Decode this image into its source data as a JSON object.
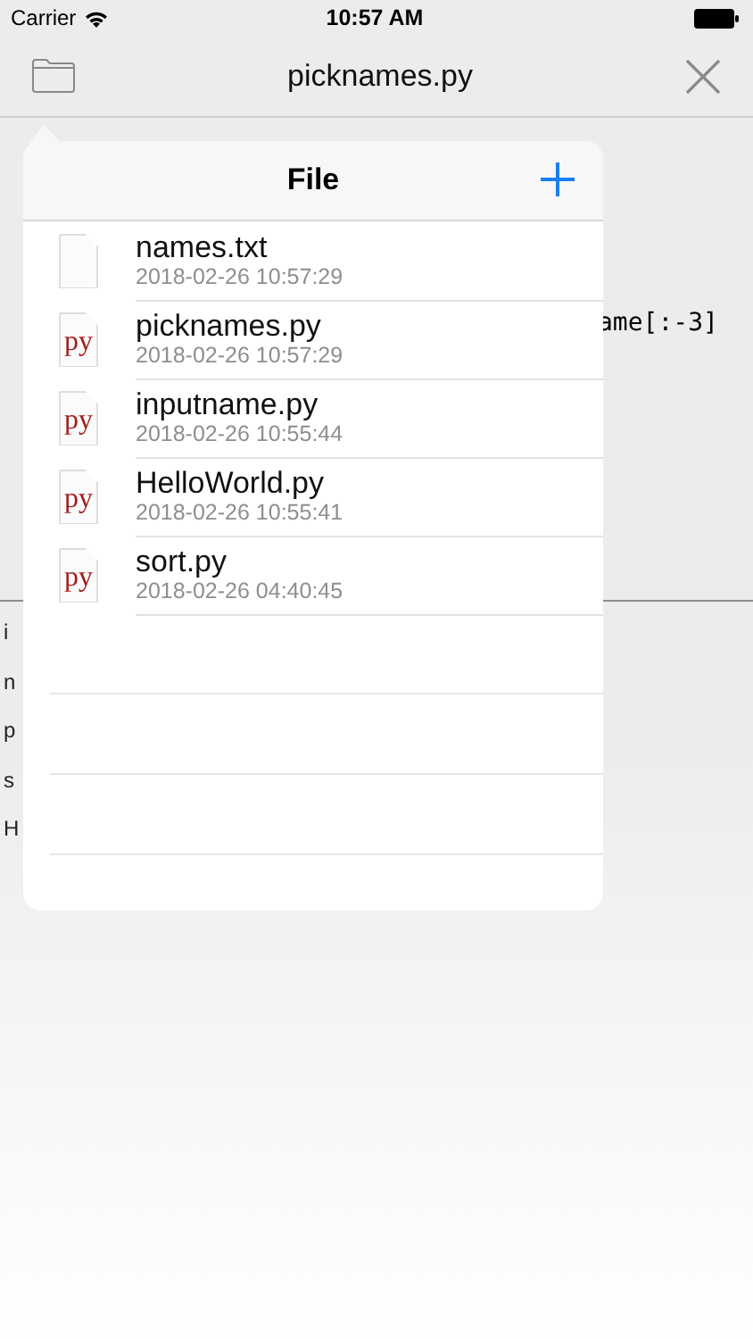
{
  "status_bar": {
    "carrier": "Carrier",
    "time": "10:57 AM"
  },
  "nav_bar": {
    "title": "picknames.py"
  },
  "editor": {
    "visible_code": [
      "ame[:-3]"
    ]
  },
  "console": {
    "lines": [
      "i",
      "n",
      "p",
      "s",
      "H"
    ]
  },
  "popover": {
    "title": "File",
    "files": [
      {
        "kind": "text",
        "name": "names.txt",
        "date": "2018-02-26 10:57:29"
      },
      {
        "kind": "python",
        "icon_label": "py",
        "name": "picknames.py",
        "date": "2018-02-26 10:57:29"
      },
      {
        "kind": "python",
        "icon_label": "py",
        "name": "inputname.py",
        "date": "2018-02-26 10:55:44"
      },
      {
        "kind": "python",
        "icon_label": "py",
        "name": "HelloWorld.py",
        "date": "2018-02-26 10:55:41"
      },
      {
        "kind": "python",
        "icon_label": "py",
        "name": "sort.py",
        "date": "2018-02-26 04:40:45"
      }
    ]
  }
}
